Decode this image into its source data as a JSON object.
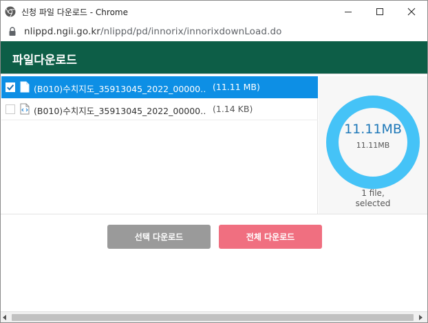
{
  "window": {
    "title": "신청 파일 다운로드 - Chrome",
    "url_host": "nlippd.ngii.go.kr",
    "url_path": "/nlippd/pd/innorix/innorixdownLoad.do"
  },
  "header": {
    "title": "파일다운로드"
  },
  "files": [
    {
      "name": "(B010)수치지도_35913045_2022_00000…",
      "size": "(11.11 MB)",
      "checked": true,
      "icon": "file-icon"
    },
    {
      "name": "(B010)수치지도_35913045_2022_00000…",
      "size": "(1.14 KB)",
      "checked": false,
      "icon": "code-file-icon"
    }
  ],
  "summary": {
    "total": "11.11MB",
    "selected_size": "11.11MB",
    "selected_count": "1 file,",
    "selected_label": "selected",
    "ring_fill": 1.0
  },
  "buttons": {
    "download_selected": "선택 다운로드",
    "download_all": "전체 다운로드"
  },
  "colors": {
    "header_bg": "#0d5e47",
    "selected_row": "#0d8fe5",
    "ring": "#45c3f7",
    "btn_selected": "#9a9a9a",
    "btn_all": "#f06f80"
  }
}
